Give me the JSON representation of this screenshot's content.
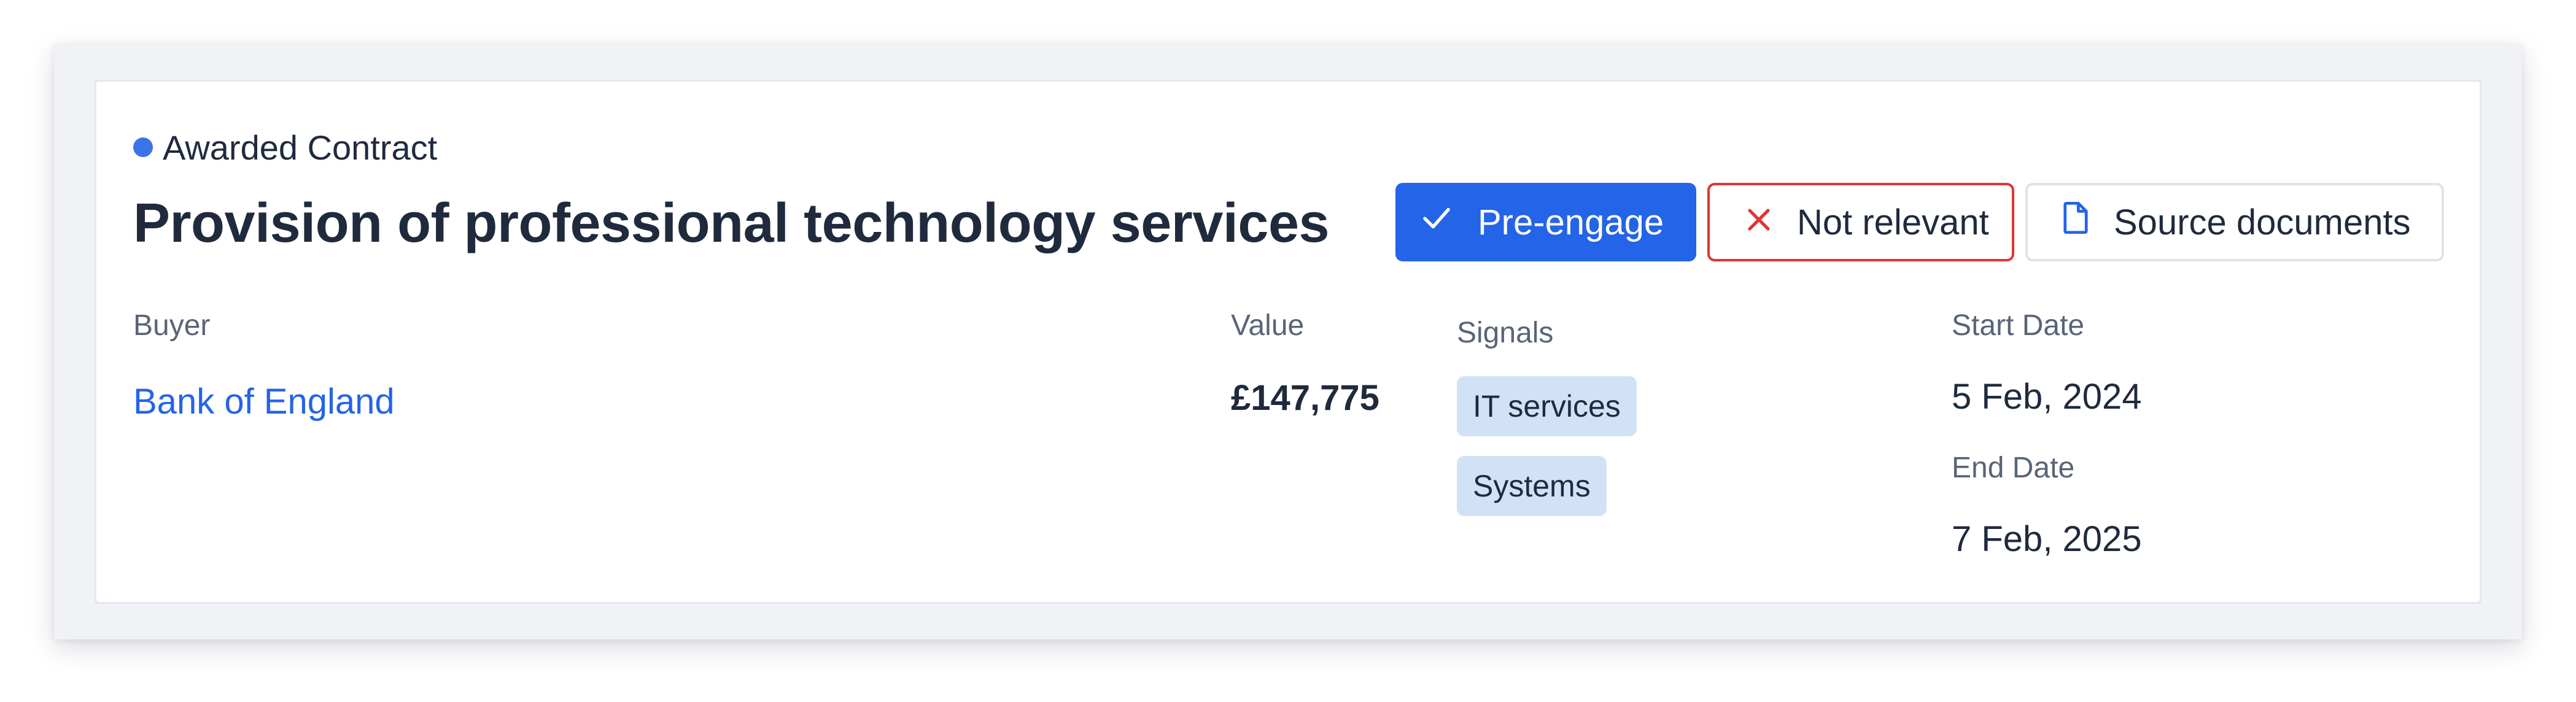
{
  "status": {
    "label": "Awarded Contract",
    "dot_color": "#3b74e8"
  },
  "title": "Provision of professional technology services",
  "actions": {
    "pre_engage": {
      "label": "Pre-engage",
      "icon": "check-icon",
      "color": "#2364e8"
    },
    "not_relevant": {
      "label": "Not relevant",
      "icon": "close-icon",
      "color": "#e23434"
    },
    "source_documents": {
      "label": "Source documents",
      "icon": "document-icon"
    }
  },
  "details": {
    "buyer": {
      "label": "Buyer",
      "value": "Bank of England"
    },
    "value": {
      "label": "Value",
      "amount": "£147,775"
    },
    "signals": {
      "label": "Signals",
      "tags": [
        "IT services",
        "Systems"
      ]
    },
    "start_date": {
      "label": "Start Date",
      "value": "5 Feb, 2024"
    },
    "end_date": {
      "label": "End Date",
      "value": "7 Feb, 2025"
    }
  }
}
